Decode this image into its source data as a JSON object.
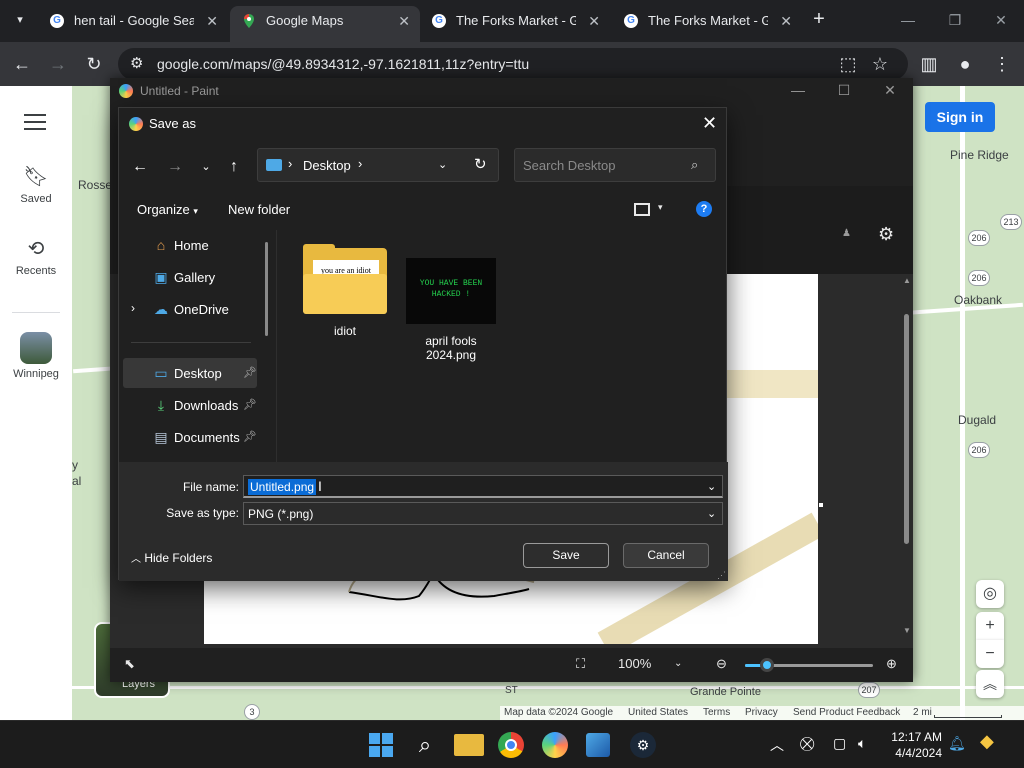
{
  "browser": {
    "tabs": [
      {
        "title": "hen tail - Google Search",
        "favicon": "G"
      },
      {
        "title": "Google Maps",
        "favicon": "maps"
      },
      {
        "title": "The Forks Market - Google Search",
        "favicon": "G"
      },
      {
        "title": "The Forks Market - Google Search",
        "favicon": "G"
      }
    ],
    "url": "google.com/maps/@49.8934312,-97.1621811,11z?entry=ttu"
  },
  "maps": {
    "sidebar": {
      "saved": "Saved",
      "recents": "Recents",
      "winnipeg": "Winnipeg"
    },
    "sign_in": "Sign in",
    "labels": {
      "rosser": "Rosse",
      "pine_ridge": "Pine Ridge",
      "oakbank": "Oakbank",
      "dugald": "Dugald",
      "left_partial_1": "y",
      "left_partial_2": "al",
      "grande_pointe": "Grande Pointe",
      "st_partial": "ST"
    },
    "shields": [
      "213",
      "206",
      "206",
      "206",
      "207",
      "3"
    ],
    "layers": "Layers",
    "footer": {
      "map_data": "Map data ©2024 Google",
      "country": "United States",
      "terms": "Terms",
      "privacy": "Privacy",
      "feedback": "Send Product Feedback",
      "scale": "2 mi"
    }
  },
  "paint": {
    "title": "Untitled - Paint",
    "zoom": "100%",
    "zoom_fraction": 0.17
  },
  "dialog": {
    "title": "Save as",
    "location": "Desktop",
    "search_placeholder": "Search Desktop",
    "organize": "Organize",
    "new_folder": "New folder",
    "nav_items": [
      {
        "label": "Home"
      },
      {
        "label": "Gallery"
      },
      {
        "label": "OneDrive"
      },
      {
        "label": "Desktop"
      },
      {
        "label": "Downloads"
      },
      {
        "label": "Documents"
      }
    ],
    "files": [
      {
        "name": "idiot",
        "preview_text": "you are an idiot"
      },
      {
        "name": "april fools 2024.png",
        "preview_line1": "YOU HAVE BEEN",
        "preview_line2": "HACKED !"
      }
    ],
    "file_name_label": "File name:",
    "file_name_value": "Untitled.png",
    "save_type_label": "Save as type:",
    "save_type_value": "PNG (*.png)",
    "hide_folders": "Hide Folders",
    "save": "Save",
    "cancel": "Cancel"
  },
  "taskbar": {
    "time": "12:17 AM",
    "date": "4/4/2024"
  },
  "colors": {
    "accent": "#1a73e8",
    "selection": "#0a6cd6",
    "folder": "#e8b93f",
    "hacked_text": "#24d04e"
  }
}
